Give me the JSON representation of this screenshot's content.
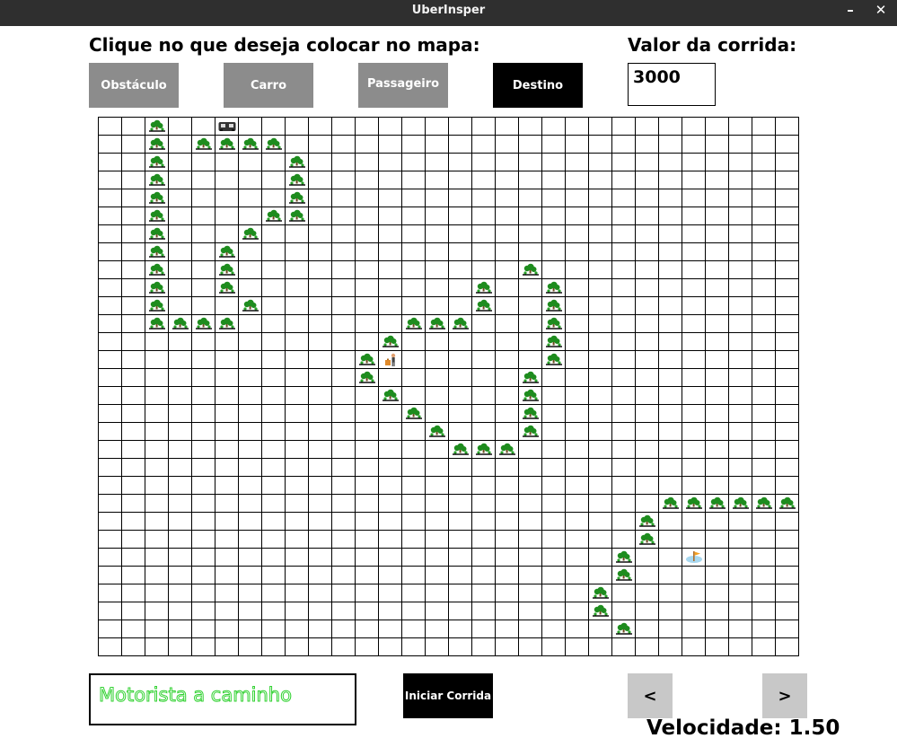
{
  "window": {
    "title": "UberInsper",
    "minimize": "–",
    "close": "✕"
  },
  "header": {
    "prompt": "Clique no que deseja colocar no mapa:",
    "fare_label": "Valor da corrida:"
  },
  "tools": [
    {
      "label": "Obstáculo",
      "selected": false
    },
    {
      "label": "Carro",
      "selected": false
    },
    {
      "label": "Passageiro",
      "selected": false
    },
    {
      "label": "Destino",
      "selected": true
    }
  ],
  "fare": {
    "value": "3000"
  },
  "grid": {
    "cols": 30,
    "rows": 30,
    "obstacles": [
      [
        2,
        0
      ],
      [
        2,
        1
      ],
      [
        4,
        1
      ],
      [
        5,
        1
      ],
      [
        6,
        1
      ],
      [
        7,
        1
      ],
      [
        2,
        2
      ],
      [
        8,
        2
      ],
      [
        2,
        3
      ],
      [
        8,
        3
      ],
      [
        2,
        4
      ],
      [
        8,
        4
      ],
      [
        2,
        5
      ],
      [
        7,
        5
      ],
      [
        8,
        5
      ],
      [
        2,
        6
      ],
      [
        6,
        6
      ],
      [
        2,
        7
      ],
      [
        5,
        7
      ],
      [
        2,
        8
      ],
      [
        5,
        8
      ],
      [
        18,
        8
      ],
      [
        2,
        9
      ],
      [
        5,
        9
      ],
      [
        16,
        9
      ],
      [
        19,
        9
      ],
      [
        2,
        10
      ],
      [
        6,
        10
      ],
      [
        16,
        10
      ],
      [
        19,
        10
      ],
      [
        2,
        11
      ],
      [
        3,
        11
      ],
      [
        4,
        11
      ],
      [
        5,
        11
      ],
      [
        13,
        11
      ],
      [
        14,
        11
      ],
      [
        15,
        11
      ],
      [
        19,
        11
      ],
      [
        12,
        12
      ],
      [
        19,
        12
      ],
      [
        11,
        13
      ],
      [
        19,
        13
      ],
      [
        11,
        14
      ],
      [
        18,
        14
      ],
      [
        12,
        15
      ],
      [
        18,
        15
      ],
      [
        13,
        16
      ],
      [
        18,
        16
      ],
      [
        14,
        17
      ],
      [
        18,
        17
      ],
      [
        15,
        18
      ],
      [
        16,
        18
      ],
      [
        17,
        18
      ],
      [
        24,
        21
      ],
      [
        25,
        21
      ],
      [
        26,
        21
      ],
      [
        27,
        21
      ],
      [
        28,
        21
      ],
      [
        29,
        21
      ],
      [
        23,
        22
      ],
      [
        23,
        23
      ],
      [
        22,
        24
      ],
      [
        22,
        25
      ],
      [
        21,
        26
      ],
      [
        21,
        27
      ],
      [
        22,
        28
      ]
    ],
    "car": [
      5,
      0
    ],
    "passenger": [
      12,
      13
    ],
    "destination": [
      25,
      24
    ]
  },
  "status": {
    "text": "Motorista a caminho",
    "color": "#33d233"
  },
  "controls": {
    "start_label": "Iniciar Corrida",
    "prev_label": "<",
    "next_label": ">"
  },
  "speed": {
    "text": "Velocidade: 1.50"
  },
  "colors": {
    "tool_bg": "#8c8c8c",
    "tool_selected_bg": "#000000",
    "obstacle": "#1e8c1e",
    "titlebar": "#2f2f2f"
  }
}
